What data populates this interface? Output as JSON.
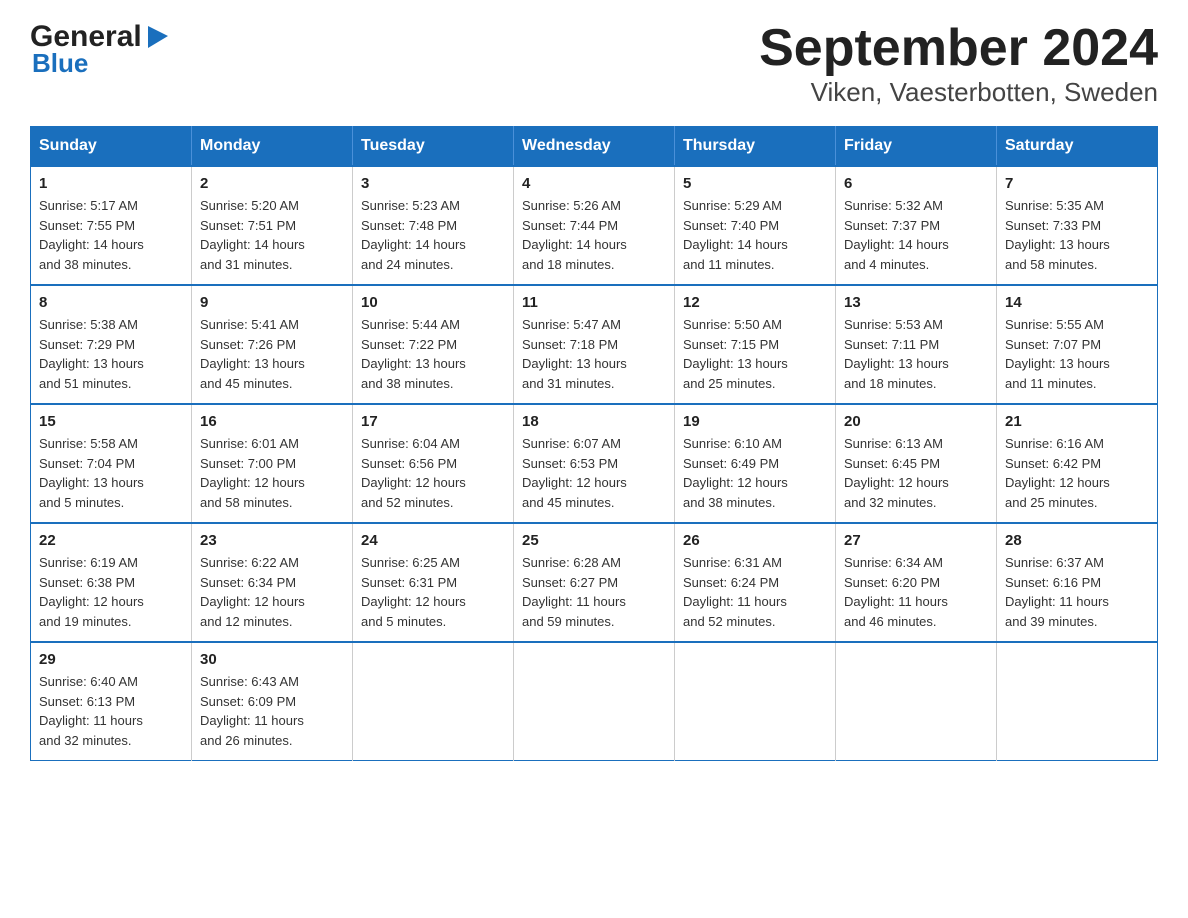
{
  "header": {
    "logo_general": "General",
    "logo_blue": "Blue",
    "title": "September 2024",
    "subtitle": "Viken, Vaesterbotten, Sweden"
  },
  "days_of_week": [
    "Sunday",
    "Monday",
    "Tuesday",
    "Wednesday",
    "Thursday",
    "Friday",
    "Saturday"
  ],
  "weeks": [
    [
      {
        "day": "1",
        "sunrise": "5:17 AM",
        "sunset": "7:55 PM",
        "daylight": "14 hours and 38 minutes."
      },
      {
        "day": "2",
        "sunrise": "5:20 AM",
        "sunset": "7:51 PM",
        "daylight": "14 hours and 31 minutes."
      },
      {
        "day": "3",
        "sunrise": "5:23 AM",
        "sunset": "7:48 PM",
        "daylight": "14 hours and 24 minutes."
      },
      {
        "day": "4",
        "sunrise": "5:26 AM",
        "sunset": "7:44 PM",
        "daylight": "14 hours and 18 minutes."
      },
      {
        "day": "5",
        "sunrise": "5:29 AM",
        "sunset": "7:40 PM",
        "daylight": "14 hours and 11 minutes."
      },
      {
        "day": "6",
        "sunrise": "5:32 AM",
        "sunset": "7:37 PM",
        "daylight": "14 hours and 4 minutes."
      },
      {
        "day": "7",
        "sunrise": "5:35 AM",
        "sunset": "7:33 PM",
        "daylight": "13 hours and 58 minutes."
      }
    ],
    [
      {
        "day": "8",
        "sunrise": "5:38 AM",
        "sunset": "7:29 PM",
        "daylight": "13 hours and 51 minutes."
      },
      {
        "day": "9",
        "sunrise": "5:41 AM",
        "sunset": "7:26 PM",
        "daylight": "13 hours and 45 minutes."
      },
      {
        "day": "10",
        "sunrise": "5:44 AM",
        "sunset": "7:22 PM",
        "daylight": "13 hours and 38 minutes."
      },
      {
        "day": "11",
        "sunrise": "5:47 AM",
        "sunset": "7:18 PM",
        "daylight": "13 hours and 31 minutes."
      },
      {
        "day": "12",
        "sunrise": "5:50 AM",
        "sunset": "7:15 PM",
        "daylight": "13 hours and 25 minutes."
      },
      {
        "day": "13",
        "sunrise": "5:53 AM",
        "sunset": "7:11 PM",
        "daylight": "13 hours and 18 minutes."
      },
      {
        "day": "14",
        "sunrise": "5:55 AM",
        "sunset": "7:07 PM",
        "daylight": "13 hours and 11 minutes."
      }
    ],
    [
      {
        "day": "15",
        "sunrise": "5:58 AM",
        "sunset": "7:04 PM",
        "daylight": "13 hours and 5 minutes."
      },
      {
        "day": "16",
        "sunrise": "6:01 AM",
        "sunset": "7:00 PM",
        "daylight": "12 hours and 58 minutes."
      },
      {
        "day": "17",
        "sunrise": "6:04 AM",
        "sunset": "6:56 PM",
        "daylight": "12 hours and 52 minutes."
      },
      {
        "day": "18",
        "sunrise": "6:07 AM",
        "sunset": "6:53 PM",
        "daylight": "12 hours and 45 minutes."
      },
      {
        "day": "19",
        "sunrise": "6:10 AM",
        "sunset": "6:49 PM",
        "daylight": "12 hours and 38 minutes."
      },
      {
        "day": "20",
        "sunrise": "6:13 AM",
        "sunset": "6:45 PM",
        "daylight": "12 hours and 32 minutes."
      },
      {
        "day": "21",
        "sunrise": "6:16 AM",
        "sunset": "6:42 PM",
        "daylight": "12 hours and 25 minutes."
      }
    ],
    [
      {
        "day": "22",
        "sunrise": "6:19 AM",
        "sunset": "6:38 PM",
        "daylight": "12 hours and 19 minutes."
      },
      {
        "day": "23",
        "sunrise": "6:22 AM",
        "sunset": "6:34 PM",
        "daylight": "12 hours and 12 minutes."
      },
      {
        "day": "24",
        "sunrise": "6:25 AM",
        "sunset": "6:31 PM",
        "daylight": "12 hours and 5 minutes."
      },
      {
        "day": "25",
        "sunrise": "6:28 AM",
        "sunset": "6:27 PM",
        "daylight": "11 hours and 59 minutes."
      },
      {
        "day": "26",
        "sunrise": "6:31 AM",
        "sunset": "6:24 PM",
        "daylight": "11 hours and 52 minutes."
      },
      {
        "day": "27",
        "sunrise": "6:34 AM",
        "sunset": "6:20 PM",
        "daylight": "11 hours and 46 minutes."
      },
      {
        "day": "28",
        "sunrise": "6:37 AM",
        "sunset": "6:16 PM",
        "daylight": "11 hours and 39 minutes."
      }
    ],
    [
      {
        "day": "29",
        "sunrise": "6:40 AM",
        "sunset": "6:13 PM",
        "daylight": "11 hours and 32 minutes."
      },
      {
        "day": "30",
        "sunrise": "6:43 AM",
        "sunset": "6:09 PM",
        "daylight": "11 hours and 26 minutes."
      },
      null,
      null,
      null,
      null,
      null
    ]
  ],
  "labels": {
    "sunrise": "Sunrise:",
    "sunset": "Sunset:",
    "daylight": "Daylight:"
  }
}
